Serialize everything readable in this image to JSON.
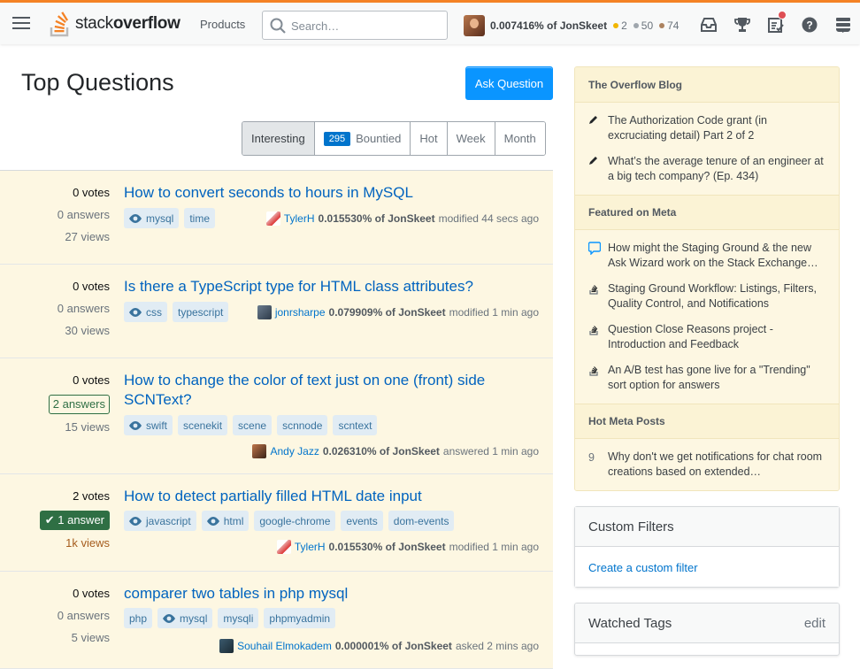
{
  "header": {
    "logo": {
      "light": "stack",
      "bold": "overflow"
    },
    "products": "Products",
    "search_placeholder": "Search…",
    "user": {
      "rep": "0.007416% of JonSkeet",
      "gold": "2",
      "silver": "50",
      "bronze": "74"
    },
    "colors": {
      "accent": "#f48225",
      "gold": "#f1b600",
      "silver": "#9fa6ad",
      "bronze": "#ab825f",
      "notif": "#de4f54"
    }
  },
  "main": {
    "title": "Top Questions",
    "ask": "Ask Question",
    "filters": {
      "interesting": "Interesting",
      "bounty_count": "295",
      "bountied": "Bountied",
      "hot": "Hot",
      "week": "Week",
      "month": "Month"
    }
  },
  "questions": [
    {
      "votes": "0 votes",
      "answers": "0 answers",
      "views": "27 views",
      "title": "How to convert seconds to hours in MySQL",
      "tags": [
        "mysql",
        "time"
      ],
      "user": "TylerH",
      "rep": "0.015530% of JonSkeet",
      "action": "modified 44 secs ago"
    },
    {
      "votes": "0 votes",
      "answers": "0 answers",
      "views": "30 views",
      "title": "Is there a TypeScript type for HTML class attributes?",
      "tags": [
        "css",
        "typescript"
      ],
      "user": "jonrsharpe",
      "rep": "0.079909% of JonSkeet",
      "action": "modified 1 min ago"
    },
    {
      "votes": "0 votes",
      "answers": "2 answers",
      "views": "15 views",
      "title": "How to change the color of text just on one (front) side SCNText?",
      "tags": [
        "swift",
        "scenekit",
        "scene",
        "scnnode",
        "scntext"
      ],
      "user": "Andy Jazz",
      "rep": "0.026310% of JonSkeet",
      "action": "answered 1 min ago"
    },
    {
      "votes": "2 votes",
      "answers": "1 answer",
      "views": "1k views",
      "title": "How to detect partially filled HTML date input",
      "tags": [
        "javascript",
        "html",
        "google-chrome",
        "events",
        "dom-events"
      ],
      "user": "TylerH",
      "rep": "0.015530% of JonSkeet",
      "action": "modified 1 min ago"
    },
    {
      "votes": "0 votes",
      "answers": "0 answers",
      "views": "5 views",
      "title": "comparer two tables in php mysql",
      "tags": [
        "php",
        "mysql",
        "mysqli",
        "phpmyadmin"
      ],
      "user": "Souhail Elmokadem",
      "rep": "0.000001% of JonSkeet",
      "action": "asked 2 mins ago"
    }
  ],
  "sidebar": {
    "blog_title": "The Overflow Blog",
    "blog_items": [
      "The Authorization Code grant (in excruciating detail) Part 2 of 2",
      "What’s the average tenure of an engineer at a big tech company? (Ep. 434)"
    ],
    "meta_title": "Featured on Meta",
    "meta_items": [
      "How might the Staging Ground & the new Ask Wizard work on the Stack Exchange…",
      "Staging Ground Workflow: Listings, Filters, Quality Control, and Notifications",
      "Question Close Reasons project - Introduction and Feedback",
      "An A/B test has gone live for a \"Trending\" sort option for answers"
    ],
    "hot_title": "Hot Meta Posts",
    "hot_count": "9",
    "hot_item": "Why don't we get notifications for chat room creations based on extended…",
    "custom_filters": "Custom Filters",
    "create_filter": "Create a custom filter",
    "watched_tags": "Watched Tags",
    "edit": "edit"
  }
}
